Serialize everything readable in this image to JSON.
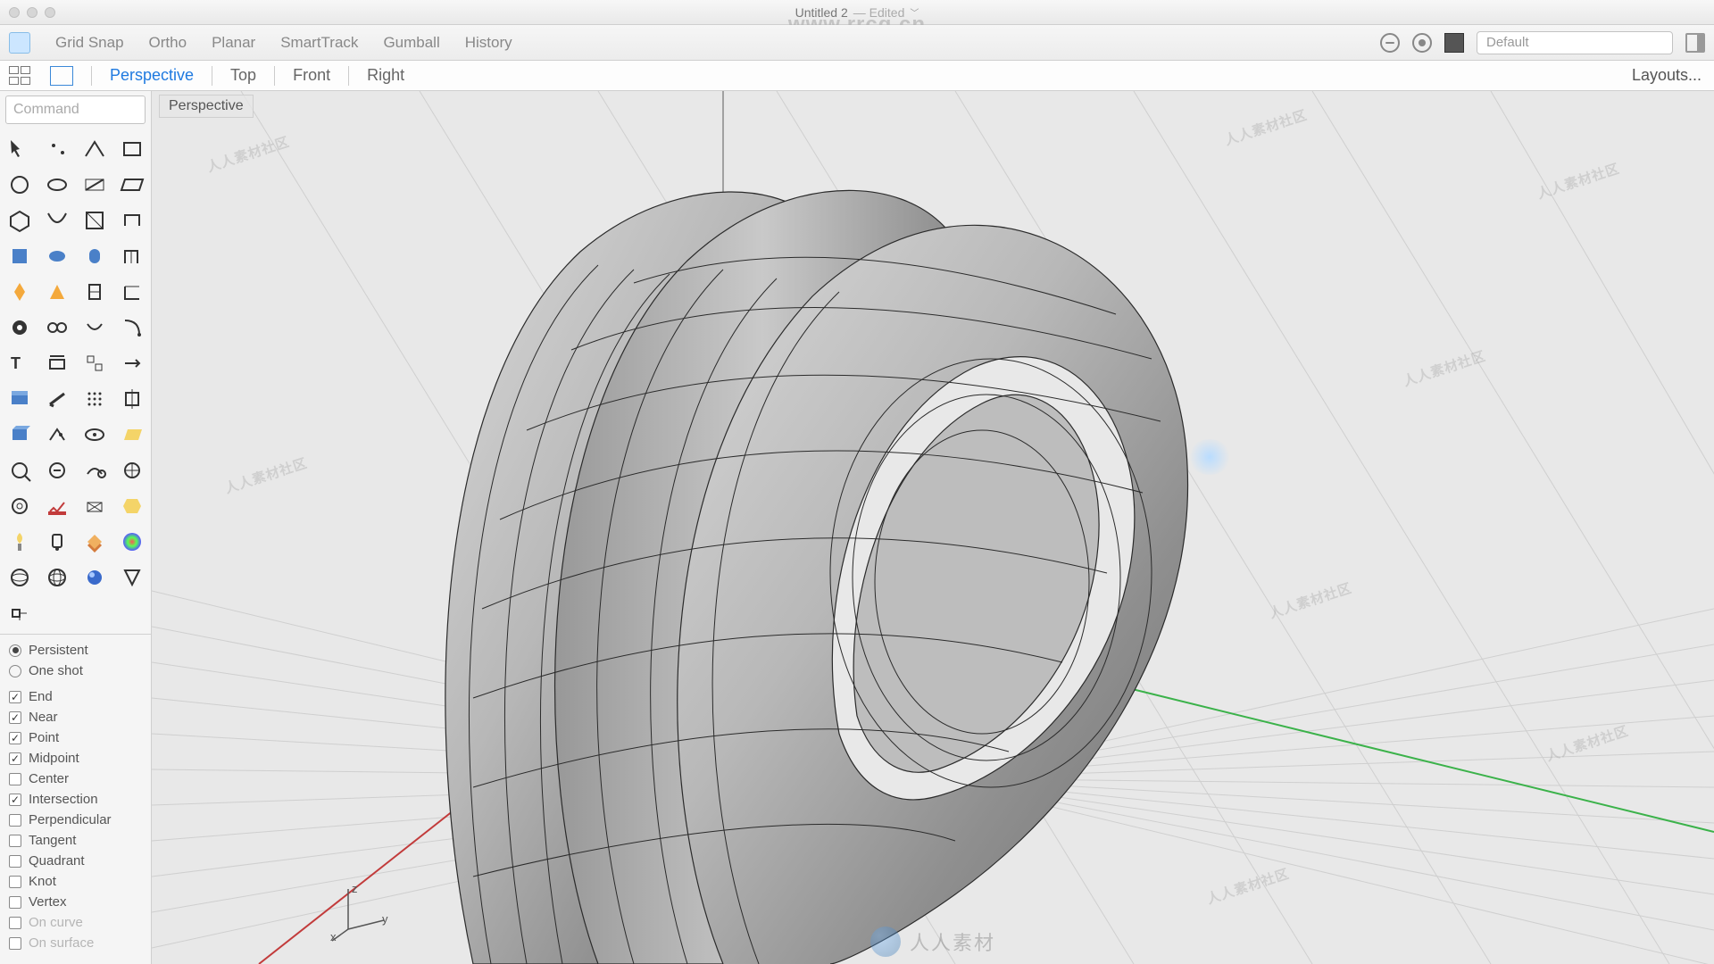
{
  "titlebar": {
    "title": "Untitled 2",
    "status": "— Edited"
  },
  "watermark": {
    "url": "www.rrcg.cn",
    "brand": "人人素材",
    "scatter": "人人素材社区"
  },
  "menubar": {
    "items": [
      "Grid Snap",
      "Ortho",
      "Planar",
      "SmartTrack",
      "Gumball",
      "History"
    ],
    "layer_label": "Default"
  },
  "viewtabs": {
    "tabs": [
      "Perspective",
      "Top",
      "Front",
      "Right"
    ],
    "active": "Perspective",
    "layouts_label": "Layouts..."
  },
  "viewport": {
    "label": "Perspective",
    "axes": {
      "z": "z",
      "y": "y",
      "x": "x"
    }
  },
  "command": {
    "placeholder": "Command"
  },
  "osnap": {
    "modes": [
      {
        "label": "Persistent",
        "selected": true
      },
      {
        "label": "One shot",
        "selected": false
      }
    ],
    "options": [
      {
        "label": "End",
        "checked": true,
        "dim": false
      },
      {
        "label": "Near",
        "checked": true,
        "dim": false
      },
      {
        "label": "Point",
        "checked": true,
        "dim": false
      },
      {
        "label": "Midpoint",
        "checked": true,
        "dim": false
      },
      {
        "label": "Center",
        "checked": false,
        "dim": false
      },
      {
        "label": "Intersection",
        "checked": true,
        "dim": false
      },
      {
        "label": "Perpendicular",
        "checked": false,
        "dim": false
      },
      {
        "label": "Tangent",
        "checked": false,
        "dim": false
      },
      {
        "label": "Quadrant",
        "checked": false,
        "dim": false
      },
      {
        "label": "Knot",
        "checked": false,
        "dim": false
      },
      {
        "label": "Vertex",
        "checked": false,
        "dim": false
      },
      {
        "label": "On curve",
        "checked": false,
        "dim": true
      },
      {
        "label": "On surface",
        "checked": false,
        "dim": true
      }
    ]
  },
  "tools": {
    "count": 56
  }
}
